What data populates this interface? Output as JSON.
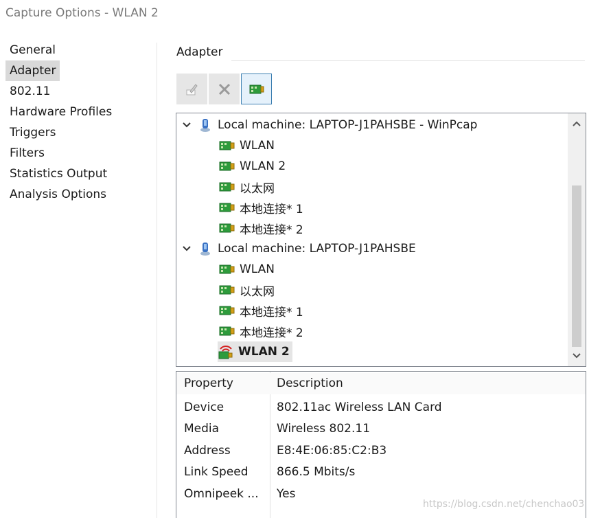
{
  "window": {
    "title": "Capture Options - WLAN 2"
  },
  "nav": {
    "items": [
      {
        "label": "General",
        "selected": false
      },
      {
        "label": "Adapter",
        "selected": true
      },
      {
        "label": "802.11",
        "selected": false
      },
      {
        "label": "Hardware Profiles",
        "selected": false
      },
      {
        "label": "Triggers",
        "selected": false
      },
      {
        "label": "Filters",
        "selected": false
      },
      {
        "label": "Statistics Output",
        "selected": false
      },
      {
        "label": "Analysis Options",
        "selected": false
      }
    ]
  },
  "section": {
    "title": "Adapter"
  },
  "toolbar": {
    "edit": "edit-icon",
    "delete": "delete-icon",
    "adapter": "network-adapter-icon"
  },
  "tree": {
    "groups": [
      {
        "label": "Local machine: LAPTOP-J1PAHSBE - WinPcap",
        "expanded": true,
        "children": [
          {
            "label": "WLAN"
          },
          {
            "label": "WLAN 2"
          },
          {
            "label": "以太网"
          },
          {
            "label": "本地连接* 1"
          },
          {
            "label": "本地连接* 2"
          }
        ]
      },
      {
        "label": "Local machine: LAPTOP-J1PAHSBE",
        "expanded": true,
        "children": [
          {
            "label": "WLAN"
          },
          {
            "label": "以太网"
          },
          {
            "label": "本地连接* 1"
          },
          {
            "label": "本地连接* 2"
          },
          {
            "label": "WLAN 2",
            "selected": true,
            "wireless": true
          }
        ]
      }
    ]
  },
  "properties": {
    "header": {
      "property": "Property",
      "description": "Description"
    },
    "rows": [
      {
        "property": "Device",
        "description": "802.11ac Wireless LAN Card"
      },
      {
        "property": "Media",
        "description": "Wireless 802.11"
      },
      {
        "property": "Address",
        "description": "E8:4E:06:85:C2:B3"
      },
      {
        "property": "Link Speed",
        "description": "866.5 Mbits/s"
      },
      {
        "property": "Omnipeek ...",
        "description": "Yes"
      }
    ]
  },
  "watermark": "https://blog.csdn.net/chenchao03",
  "colors": {
    "selection": "#d9d9d9",
    "accent_border": "#3c7fb1",
    "adapter_green": "#2e9b3c"
  }
}
